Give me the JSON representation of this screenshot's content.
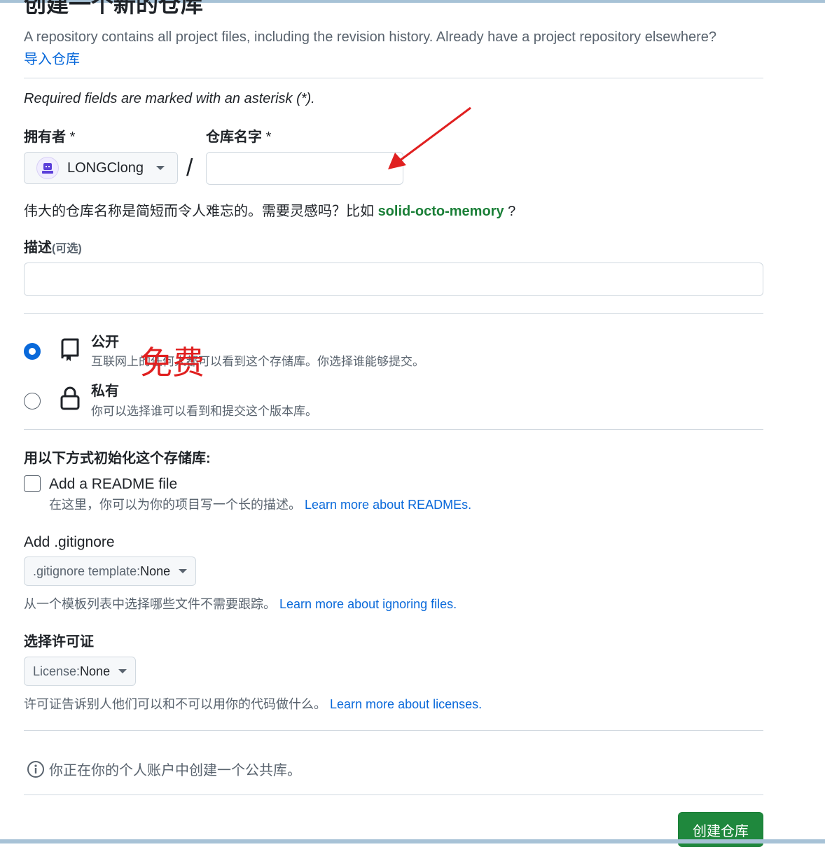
{
  "header": {
    "title": "创建一个新的仓库",
    "subtitle": "A repository contains all project files, including the revision history. Already have a project repository elsewhere?",
    "import_link": "导入仓库"
  },
  "form": {
    "required_note": "Required fields are marked with an asterisk (*).",
    "owner": {
      "label": "拥有者",
      "asterisk": "*",
      "value": "LONGClong"
    },
    "separator": "/",
    "repo_name": {
      "label": "仓库名字",
      "asterisk": "*",
      "value": ""
    },
    "name_hint": {
      "text": "伟大的仓库名称是简短而令人难忘的。需要灵感吗？比如",
      "suggestion": "solid-octo-memory",
      "suffix": "?"
    },
    "description": {
      "label": "描述",
      "optional": "(可选)",
      "value": ""
    }
  },
  "visibility": {
    "options": [
      {
        "title": "公开",
        "desc": "互联网上的任何人都可以看到这个存储库。你选择谁能够提交。",
        "checked": true,
        "icon": "repo-icon"
      },
      {
        "title": "私有",
        "desc": "你可以选择谁可以看到和提交这个版本库。",
        "checked": false,
        "icon": "lock-icon"
      }
    ],
    "annotation": "免费"
  },
  "init": {
    "heading": "用以下方式初始化这个存储库:",
    "readme": {
      "label": "Add a README file",
      "checked": false,
      "desc": "在这里，你可以为你的项目写一个长的描述。",
      "link": "Learn more about READMEs."
    },
    "gitignore": {
      "label": "Add .gitignore",
      "select_key": ".gitignore template:",
      "select_value": "None",
      "desc": "从一个模板列表中选择哪些文件不需要跟踪。",
      "link": "Learn more about ignoring files."
    },
    "license": {
      "label": "选择许可证",
      "select_key": "License:",
      "select_value": "None",
      "desc": "许可证告诉别人他们可以和不可以用你的代码做什么。",
      "link": "Learn more about licenses."
    }
  },
  "footer": {
    "info": "你正在你的个人账户中创建一个公共库。",
    "submit": "创建仓库"
  },
  "colors": {
    "accent": "#0969da",
    "success": "#1f883d",
    "suggestion": "#1a7f37",
    "annotation": "#e02020"
  }
}
